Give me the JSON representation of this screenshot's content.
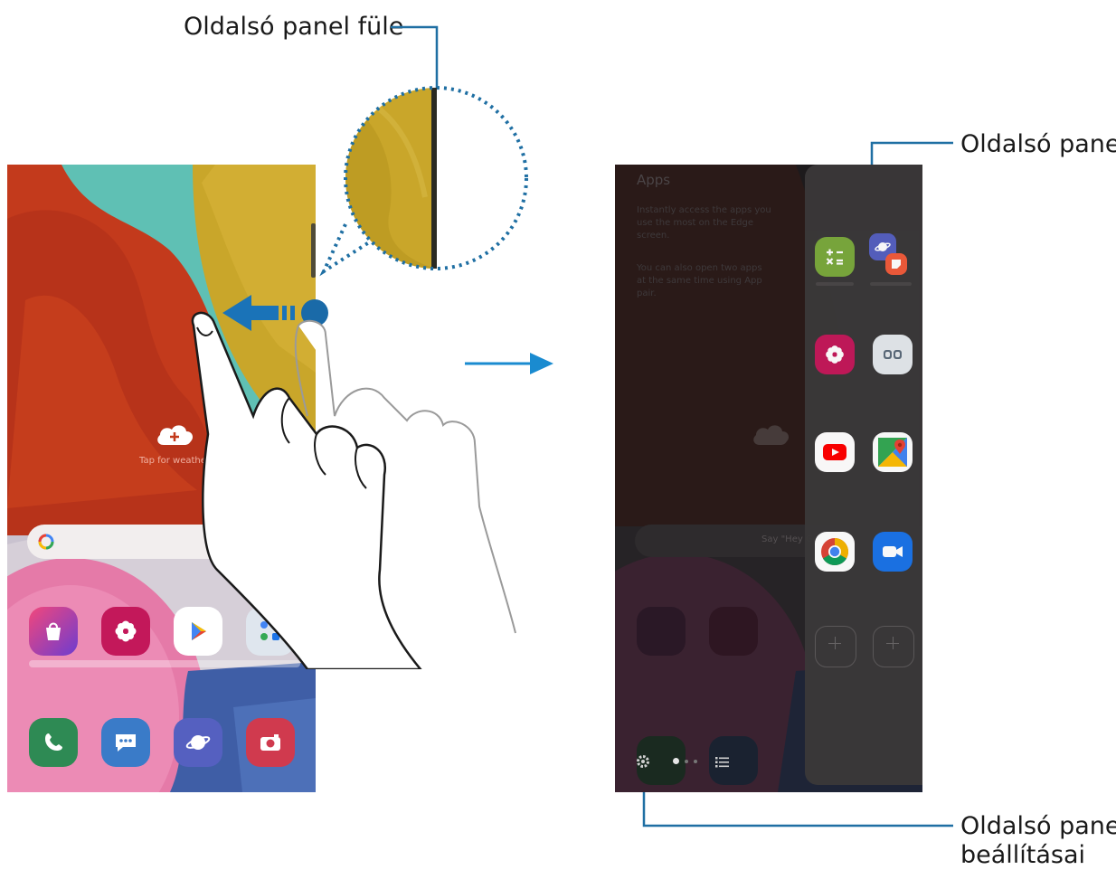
{
  "callouts": {
    "edge_handle": "Oldalsó panel füle",
    "edge_panel": "Oldalsó panel",
    "edge_panel_settings_line1": "Oldalsó panel",
    "edge_panel_settings_line2": "beállításai"
  },
  "left_phone": {
    "weather_prompt": "Tap for weather",
    "dock_apps": [
      "Phone",
      "Messages",
      "Internet",
      "Camera"
    ],
    "home_apps": [
      "Galaxy Store",
      "Gallery",
      "Play Store",
      "Google"
    ]
  },
  "right_phone": {
    "background_title": "Apps",
    "background_text_1": "Instantly access the apps you use the most on the Edge screen.",
    "background_text_2": "You can also open two apps at the same time using App pair.",
    "search_hint": "Say \"Hey Google\"",
    "panel_apps": [
      "Calculator",
      "Internet Samsung(2)",
      "Gallery",
      "Folder",
      "YouTube",
      "Maps",
      "Chrome",
      "Duo"
    ]
  },
  "colors": {
    "leader_line": "#1f6fa3",
    "arrow_blue": "#1a8bd0",
    "teal": "#5fc0b4",
    "red_fabric": "#c33a1c",
    "yellow_fabric": "#c9a62a"
  }
}
